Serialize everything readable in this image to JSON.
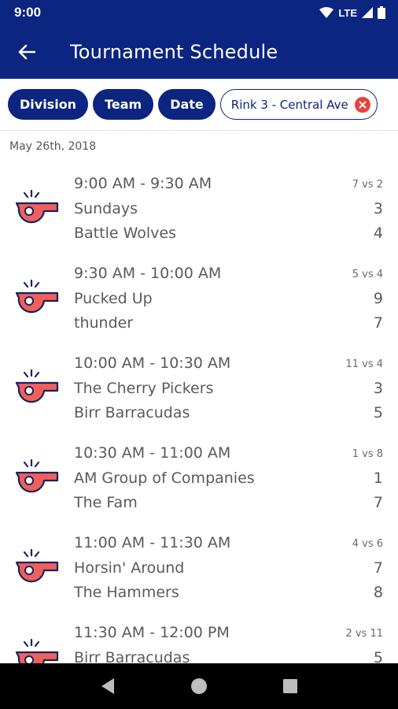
{
  "status": {
    "time": "9:00",
    "network": "LTE"
  },
  "app_bar": {
    "title": "Tournament Schedule"
  },
  "filters": {
    "chips": [
      "Division",
      "Team",
      "Date"
    ],
    "active_filter": "Rink 3 - Central Ave"
  },
  "date_header": "May 26th, 2018",
  "colors": {
    "primary": "#0b2580",
    "whistle": "#f0605a",
    "close": "#e8413b"
  },
  "games": [
    {
      "time": "9:00 AM - 9:30 AM",
      "matchup": "7 vs 2",
      "team1": "Sundays",
      "score1": "3",
      "team2": "Battle Wolves",
      "score2": "4"
    },
    {
      "time": "9:30 AM - 10:00 AM",
      "matchup": "5 vs 4",
      "team1": "Pucked Up",
      "score1": "9",
      "team2": "thunder",
      "score2": "7"
    },
    {
      "time": "10:00 AM - 10:30 AM",
      "matchup": "11 vs 4",
      "team1": "The Cherry Pickers",
      "score1": "3",
      "team2": "Birr Barracudas",
      "score2": "5"
    },
    {
      "time": "10:30 AM - 11:00 AM",
      "matchup": "1 vs 8",
      "team1": "AM Group of Companies",
      "score1": "1",
      "team2": "The Fam",
      "score2": "7"
    },
    {
      "time": "11:00 AM - 11:30 AM",
      "matchup": "4 vs 6",
      "team1": "Horsin' Around",
      "score1": "7",
      "team2": "The Hammers",
      "score2": "8"
    },
    {
      "time": "11:30 AM - 12:00 PM",
      "matchup": "2 vs 11",
      "team1": "Birr Barracudas",
      "score1": "5",
      "team2": "",
      "score2": ""
    }
  ]
}
